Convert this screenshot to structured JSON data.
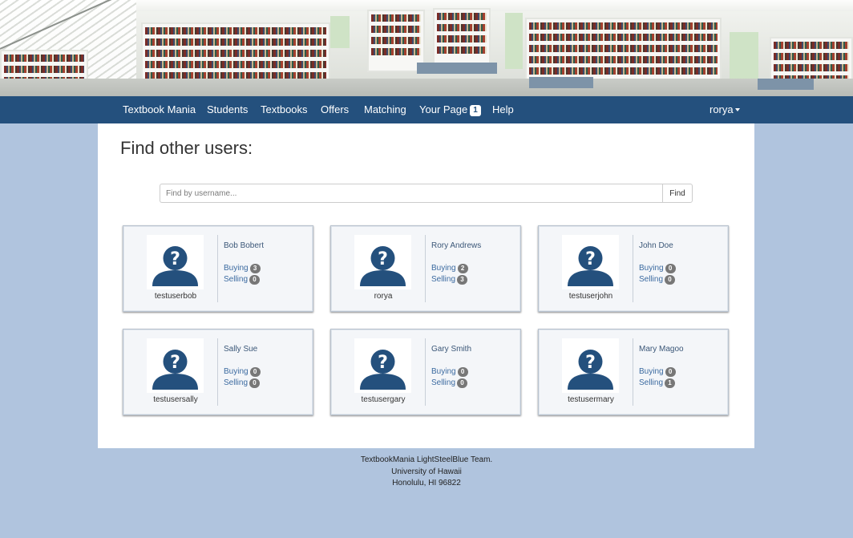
{
  "nav": {
    "brand": "Textbook Mania",
    "items": [
      {
        "label": "Students"
      },
      {
        "label": "Textbooks"
      },
      {
        "label": "Offers"
      },
      {
        "label": "Matching"
      },
      {
        "label": "Your Page",
        "badge": "1"
      },
      {
        "label": "Help"
      }
    ],
    "user": "rorya"
  },
  "main": {
    "title": "Find other users:",
    "search": {
      "placeholder": "Find by username...",
      "value": "",
      "button_label": "Find"
    },
    "cards": [
      {
        "username": "testuserbob",
        "name": "Bob Bobert",
        "buying_label": "Buying",
        "buying": "3",
        "selling_label": "Selling",
        "selling": "0"
      },
      {
        "username": "rorya",
        "name": "Rory Andrews",
        "buying_label": "Buying",
        "buying": "2",
        "selling_label": "Selling",
        "selling": "3"
      },
      {
        "username": "testuserjohn",
        "name": "John Doe",
        "buying_label": "Buying",
        "buying": "0",
        "selling_label": "Selling",
        "selling": "0"
      },
      {
        "username": "testusersally",
        "name": "Sally Sue",
        "buying_label": "Buying",
        "buying": "0",
        "selling_label": "Selling",
        "selling": "0"
      },
      {
        "username": "testusergary",
        "name": "Gary Smith",
        "buying_label": "Buying",
        "buying": "0",
        "selling_label": "Selling",
        "selling": "0"
      },
      {
        "username": "testusermary",
        "name": "Mary Magoo",
        "buying_label": "Buying",
        "buying": "0",
        "selling_label": "Selling",
        "selling": "1"
      }
    ]
  },
  "footer": {
    "line1": "TextbookMania LightSteelBlue Team.",
    "line2": "University of Hawaii",
    "line3": "Honolulu, HI 96822"
  },
  "colors": {
    "navbar": "#24507d",
    "background": "#b0c4de",
    "avatar": "#24507d",
    "badge": "#777777"
  },
  "icons": {
    "avatar": "unknown-user-icon",
    "user_menu": "caret-down-icon",
    "banner": "library-banner-image"
  }
}
